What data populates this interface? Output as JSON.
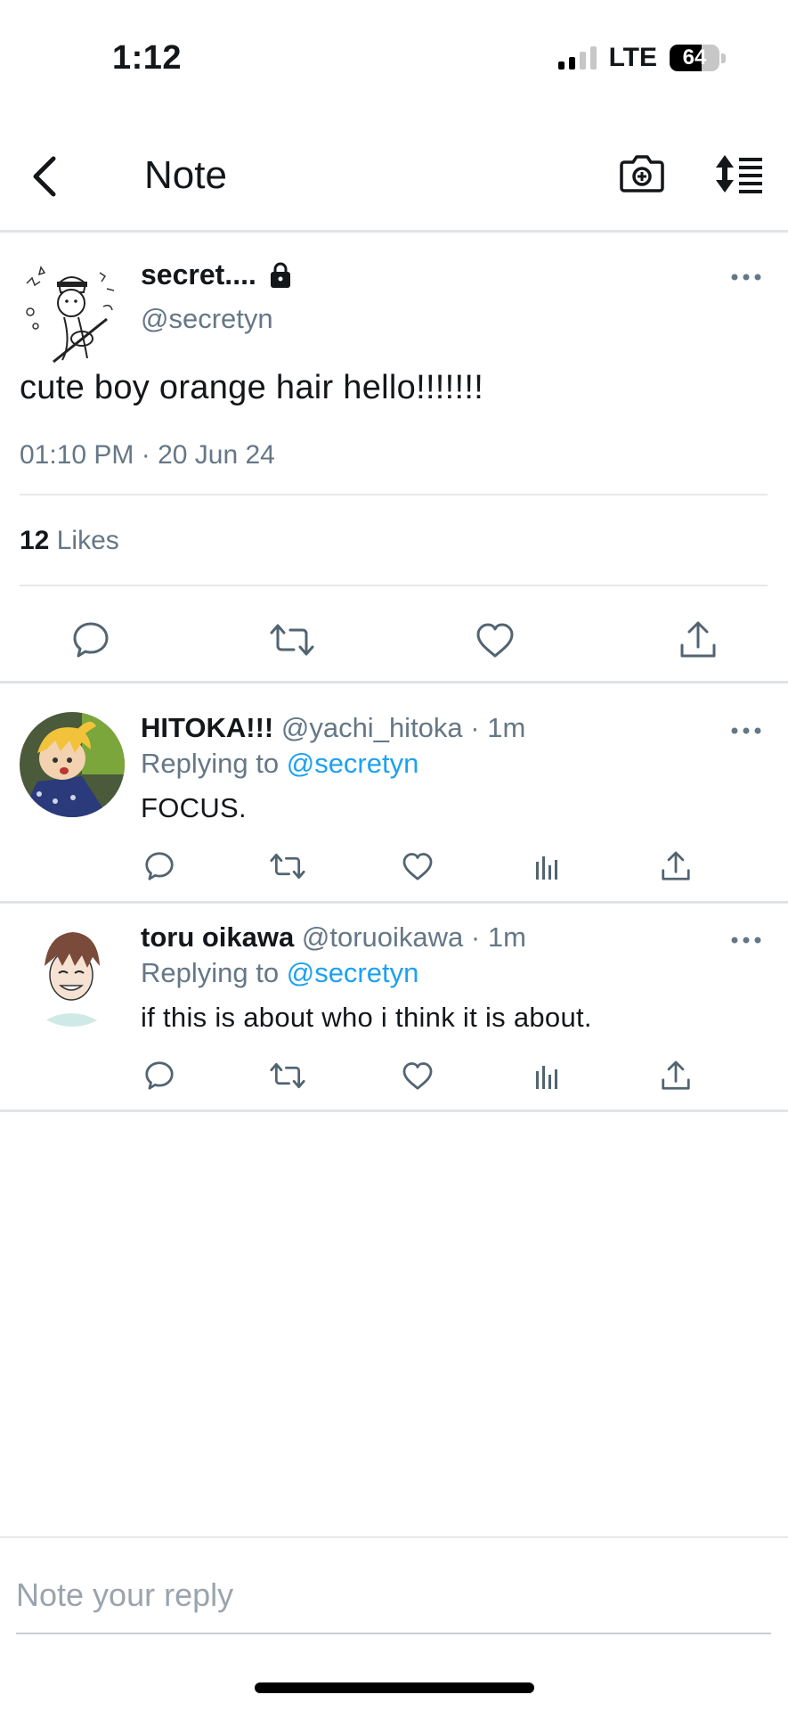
{
  "status_bar": {
    "time": "1:12",
    "network": "LTE",
    "battery": "64",
    "battery_level": 0.64,
    "signal_bars_active": 2
  },
  "header": {
    "title": "Note",
    "back_icon": "chevron-left-icon",
    "camera_icon": "camera-plus-icon",
    "sort_icon": "sort-icon"
  },
  "note": {
    "author_name": "secret....",
    "author_handle": "@secretyn",
    "text": "cute boy orange hair hello!!!!!!!",
    "timestamp": "01:10 PM · 20 Jun 24",
    "likes_count": "12",
    "likes_label": "Likes"
  },
  "replies": [
    {
      "name": "HITOKA!!!",
      "handle": "@yachi_hitoka",
      "time": "· 1m",
      "replying_prefix": "Replying to",
      "replying_to": "@secretyn",
      "text": "FOCUS."
    },
    {
      "name": "toru oikawa",
      "handle": "@toruoikawa",
      "time": "· 1m",
      "replying_prefix": "Replying to",
      "replying_to": "@secretyn",
      "text": "if this is about who i think it is about."
    }
  ],
  "reply_box": {
    "placeholder": "Note your reply"
  },
  "colors": {
    "text": "#14171a",
    "secondary": "#657786",
    "link": "#1da1f2",
    "divider": "#e1e4e6"
  }
}
